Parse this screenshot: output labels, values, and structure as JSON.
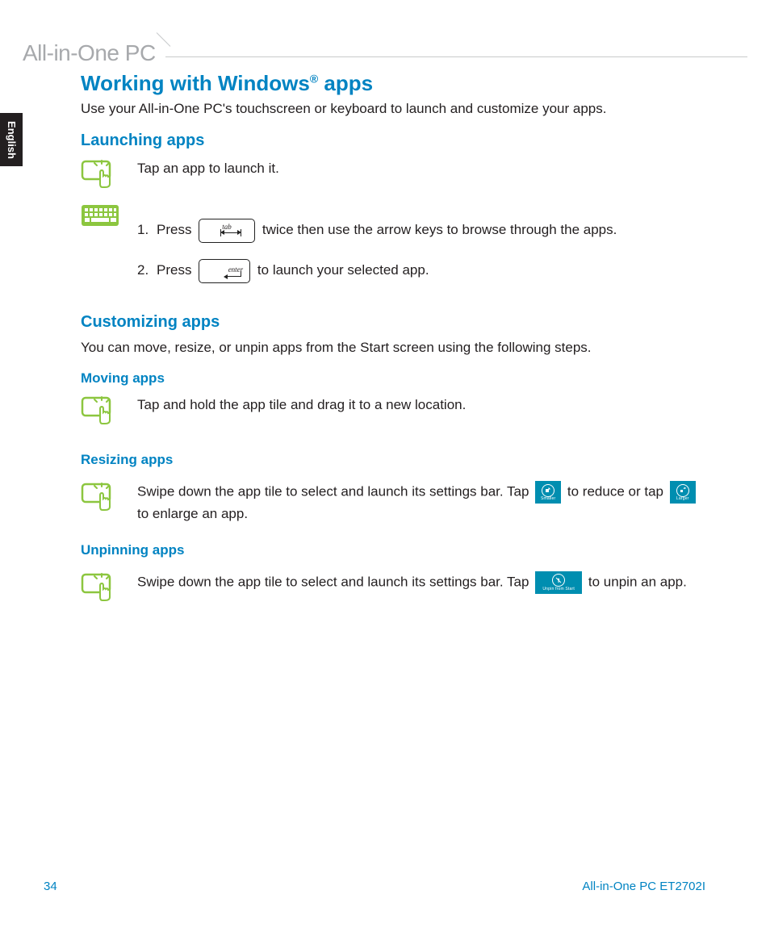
{
  "header": {
    "product_line": "All-in-One PC"
  },
  "language_tab": "English",
  "page": {
    "title_pre": "Working with Windows",
    "title_reg": "®",
    "title_post": " apps",
    "intro": "Use your All-in-One PC's touchscreen or keyboard to launch and customize your apps."
  },
  "launching": {
    "heading": "Launching apps",
    "tap_text": "Tap an app to launch it.",
    "step1_a": "Press ",
    "step1_b": " twice then use the arrow keys to browse through the apps.",
    "step2_a": "Press ",
    "step2_b": " to launch your selected app.",
    "tab_key_label": "tab",
    "enter_key_label": "enter"
  },
  "customizing": {
    "heading": "Customizing apps",
    "intro": "You can move, resize, or unpin apps from the Start screen using the following steps."
  },
  "moving": {
    "heading": "Moving apps",
    "text": "Tap and hold the app tile and drag it to a new location."
  },
  "resizing": {
    "heading": "Resizing apps",
    "text_a": "Swipe down the app tile to select and launch its settings bar. Tap ",
    "text_b": " to reduce or tap ",
    "text_c": " to enlarge an app.",
    "smaller_label": "Smaller",
    "larger_label": "Larger"
  },
  "unpinning": {
    "heading": "Unpinning apps",
    "text_a": "Swipe down the app tile to select and launch its settings bar. Tap ",
    "text_b": " to unpin an app.",
    "unpin_label": "Unpin from Start"
  },
  "footer": {
    "page_number": "34",
    "model": "All-in-One PC ET2702I"
  }
}
